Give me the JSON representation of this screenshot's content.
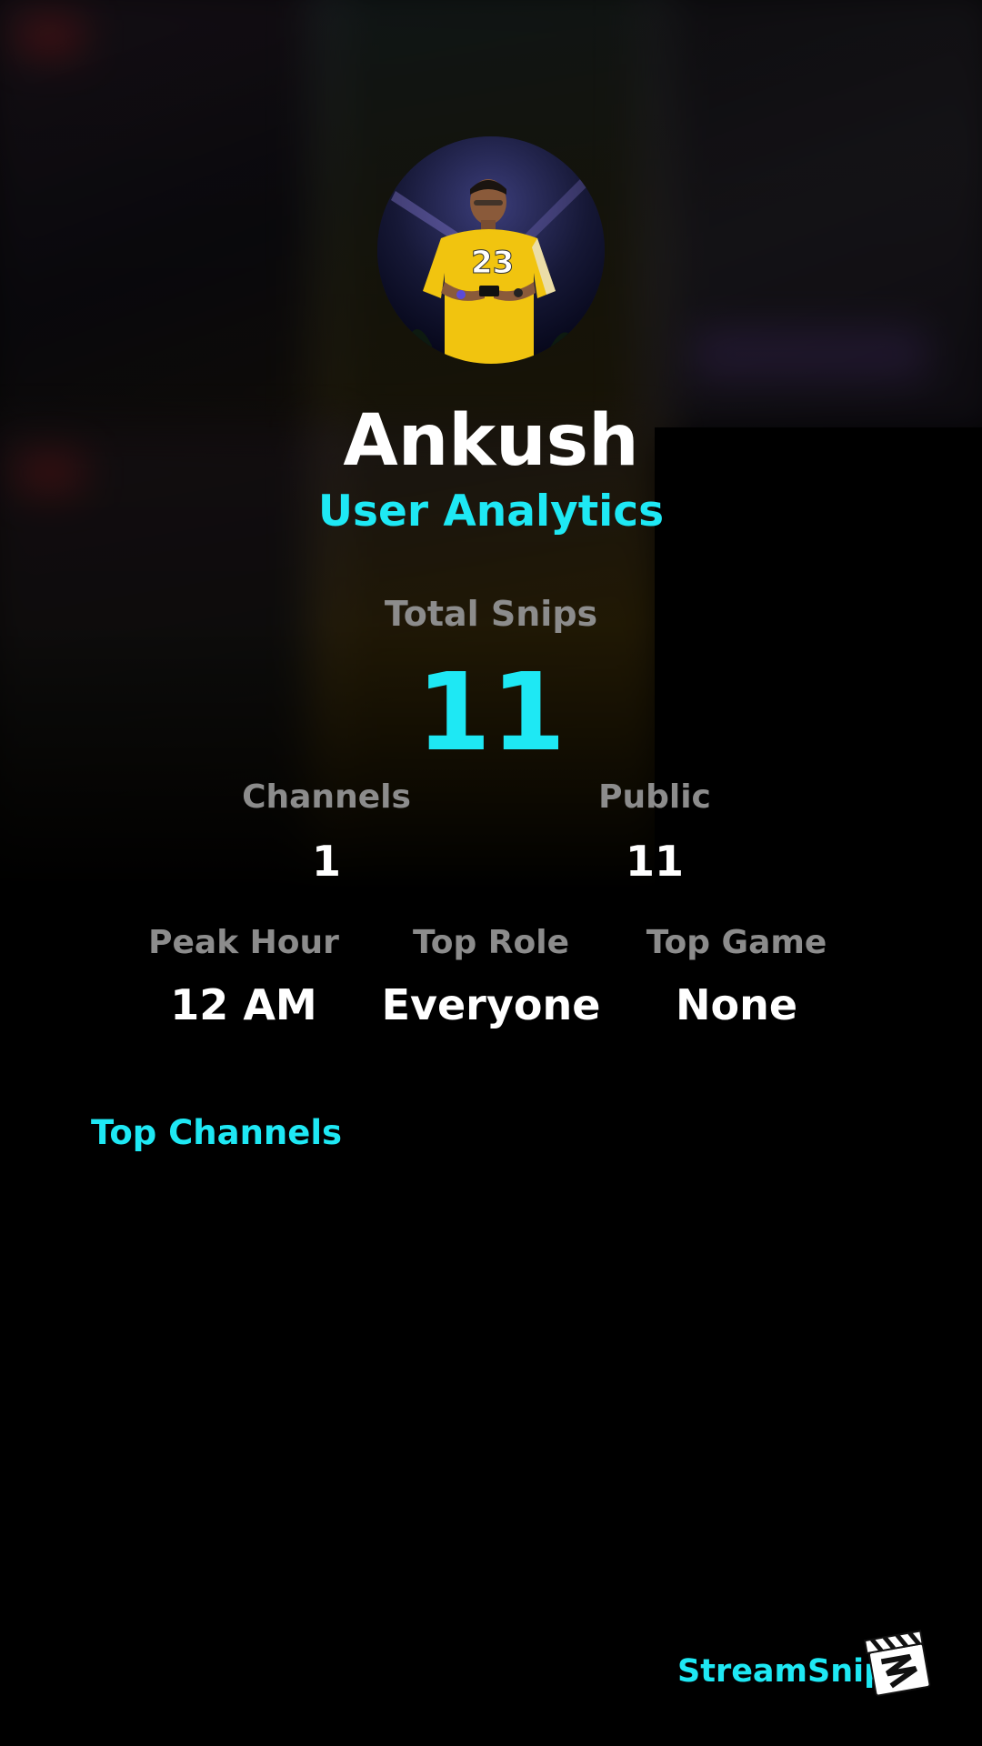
{
  "profile": {
    "name": "Ankush",
    "subtitle": "User Analytics",
    "avatar_icon": "user-avatar-photo"
  },
  "totals": {
    "total_snips_label": "Total Snips",
    "total_snips_value": "11"
  },
  "stats_row1": [
    {
      "label": "Channels",
      "value": "1"
    },
    {
      "label": "Public",
      "value": "11"
    }
  ],
  "stats_row2": [
    {
      "label": "Peak Hour",
      "value": "12 AM"
    },
    {
      "label": "Top Role",
      "value": "Everyone"
    },
    {
      "label": "Top Game",
      "value": "None"
    }
  ],
  "top_channels": {
    "title": "Top Channels",
    "items": []
  },
  "brand": {
    "name": "StreamSnip",
    "logo_icon": "clapperboard-logo-icon"
  },
  "colors": {
    "accent": "#1ee8f4",
    "label": "#8c8c8c",
    "text": "#ffffff",
    "background": "#000000"
  }
}
